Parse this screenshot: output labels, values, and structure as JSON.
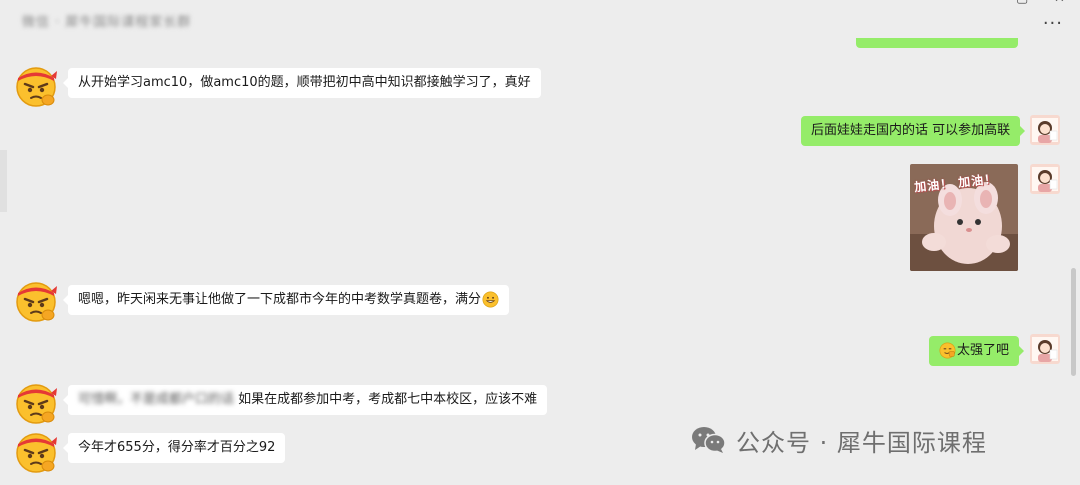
{
  "header": {
    "title": "微信 · 犀牛国际课程家长群",
    "more_label": "···"
  },
  "messages": [
    {
      "id": "m1",
      "side": "in",
      "text": "从开始学习amc10，做amc10的题，顺带把初中高中知识都接触学习了，真好"
    },
    {
      "id": "m2",
      "side": "out",
      "text": "后面娃娃走国内的话  可以参加高联"
    },
    {
      "id": "m3",
      "side": "out",
      "type": "sticker",
      "sticker_text": "加油！ 加油！"
    },
    {
      "id": "m4",
      "side": "in",
      "text": "嗯嗯，昨天闲来无事让他做了一下成都市今年的中考数学真题卷，满分",
      "emoji": "grin-emoji"
    },
    {
      "id": "m5",
      "side": "out",
      "text": "太强了吧",
      "emoji": "thumbs-up-face-emoji"
    },
    {
      "id": "m6",
      "side": "in",
      "blurred_prefix": "可惜啊，不是成都户口的话",
      "text": "如果在成都参加中考，考成都七中本校区，应该不难"
    },
    {
      "id": "m7",
      "side": "in",
      "text": "今年才655分，得分率才百分之92"
    }
  ],
  "watermark": {
    "icon": "wechat-logo-icon",
    "text": "公众号 · 犀牛国际课程"
  },
  "colors": {
    "background": "#ededed",
    "incoming_bubble": "#ffffff",
    "outgoing_bubble": "#95ec69"
  }
}
